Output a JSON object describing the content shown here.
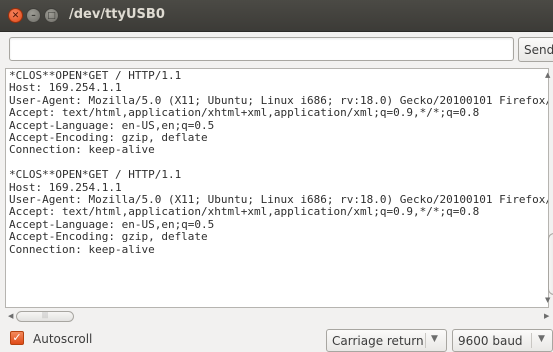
{
  "window": {
    "title": "/dev/ttyUSB0"
  },
  "input": {
    "value": "",
    "send_label": "Send"
  },
  "output": {
    "lines": [
      "*CLOS**OPEN*GET / HTTP/1.1",
      "Host: 169.254.1.1",
      "User-Agent: Mozilla/5.0 (X11; Ubuntu; Linux i686; rv:18.0) Gecko/20100101 Firefox/",
      "Accept: text/html,application/xhtml+xml,application/xml;q=0.9,*/*;q=0.8",
      "Accept-Language: en-US,en;q=0.5",
      "Accept-Encoding: gzip, deflate",
      "Connection: keep-alive",
      "",
      "*CLOS**OPEN*GET / HTTP/1.1",
      "Host: 169.254.1.1",
      "User-Agent: Mozilla/5.0 (X11; Ubuntu; Linux i686; rv:18.0) Gecko/20100101 Firefox/",
      "Accept: text/html,application/xhtml+xml,application/xml;q=0.9,*/*;q=0.8",
      "Accept-Language: en-US,en;q=0.5",
      "Accept-Encoding: gzip, deflate",
      "Connection: keep-alive"
    ]
  },
  "bottom": {
    "autoscroll_label": "Autoscroll",
    "autoscroll_checked": true,
    "line_ending": "Carriage return",
    "baud_rate": "9600 baud"
  },
  "colors": {
    "accent": "#df4a18",
    "titlebar": "#3c3b37"
  }
}
